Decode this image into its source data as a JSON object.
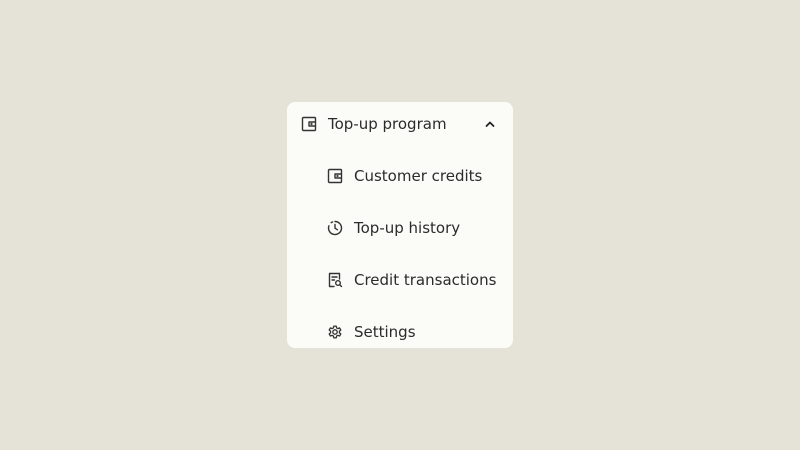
{
  "colors": {
    "background": "#e5e2d7",
    "panel": "#fbfcf7",
    "text": "#2b2b2b",
    "icon": "#333333"
  },
  "menu": {
    "header": {
      "label": "Top-up program",
      "icon": "wallet-icon",
      "expanded": true,
      "toggle_icon": "chevron-up-icon"
    },
    "items": [
      {
        "label": "Customer credits",
        "icon": "wallet-icon"
      },
      {
        "label": "Top-up history",
        "icon": "history-clock-icon"
      },
      {
        "label": "Credit transactions",
        "icon": "receipt-search-icon"
      },
      {
        "label": "Settings",
        "icon": "gear-icon"
      }
    ]
  }
}
